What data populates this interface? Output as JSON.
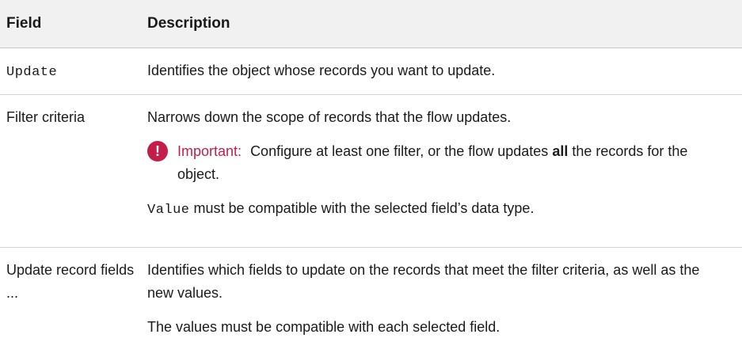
{
  "table": {
    "headers": {
      "field": "Field",
      "description": "Description"
    },
    "rows": [
      {
        "field": "Update",
        "description": "Identifies the object whose records you want to update."
      },
      {
        "field": "Filter criteria",
        "description": "Narrows down the scope of records that the flow updates.",
        "important": {
          "label": "Important:",
          "text_before": "Configure at least one filter, or the flow updates",
          "text_bold": "all",
          "text_after": "the records for the object."
        },
        "note_code": "Value",
        "note_text": "must be compatible with the selected field’s data type."
      },
      {
        "field": "Update record fields ...",
        "description": "Identifies which fields to update on the records that meet the filter criteria, as well as the new values.",
        "note": "The values must be compatible with each selected field."
      }
    ]
  },
  "icons": {
    "important_icon": "exclamation-circle-icon",
    "important_color": "#c51d4a"
  }
}
